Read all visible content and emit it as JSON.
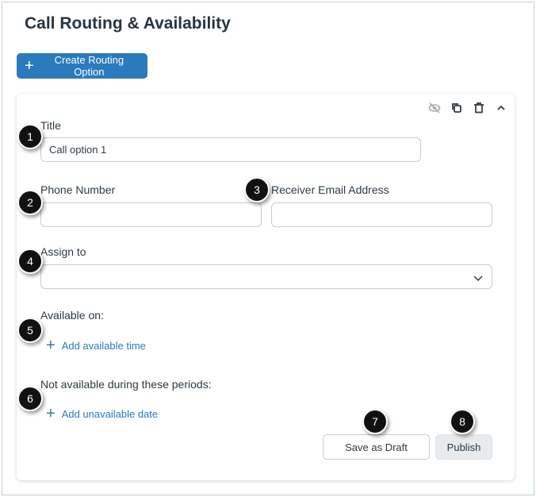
{
  "page": {
    "title": "Call Routing & Availability",
    "create_label": "Create Routing Option"
  },
  "card": {
    "title_label": "Title",
    "title_value": "Call option 1",
    "phone_label": "Phone Number",
    "phone_value": "",
    "email_label": "Receiver Email Address",
    "email_value": "",
    "assign_label": "Assign to",
    "assign_value": "",
    "available_label": "Available on:",
    "add_available": "Add available time",
    "unavailable_label": "Not available during these periods:",
    "add_unavailable": "Add unavailable date",
    "draft_label": "Save as Draft",
    "publish_label": "Publish"
  },
  "badges": [
    "1",
    "2",
    "3",
    "4",
    "5",
    "6",
    "7",
    "8"
  ],
  "colors": {
    "accent": "#2b7abc",
    "text": "#2d3b45"
  }
}
